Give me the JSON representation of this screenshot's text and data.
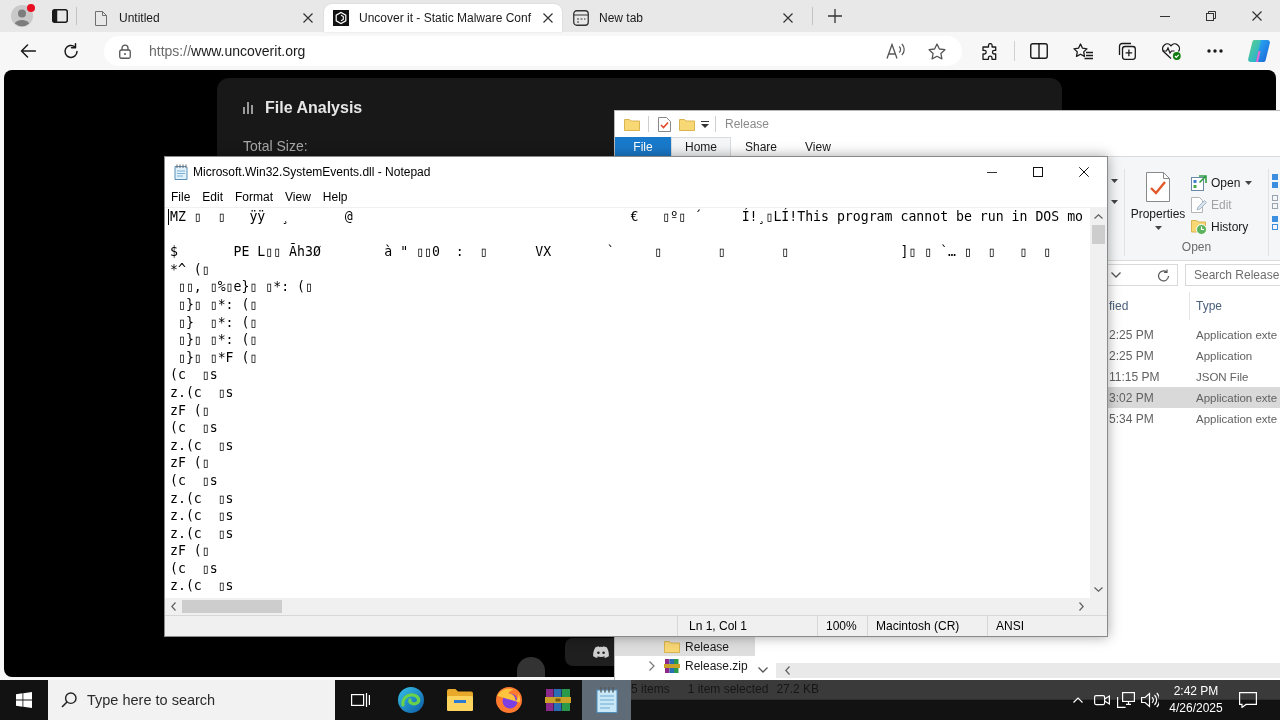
{
  "browser": {
    "profile": {
      "alert": true
    },
    "tabs": [
      {
        "kind": "page",
        "title": "Untitled",
        "selected": false
      },
      {
        "kind": "site",
        "title": "Uncover it - Static Malware Conf",
        "selected": true
      },
      {
        "kind": "newtab",
        "title": "New tab",
        "selected": false
      }
    ],
    "address": {
      "scheme": "https://",
      "host": "www.uncoverit.org"
    }
  },
  "page": {
    "heading": "File Analysis",
    "field_label": "Total Size:"
  },
  "explorer": {
    "title": "Release",
    "ribbon_tabs": [
      {
        "label": "File",
        "kind": "menu",
        "selected": false
      },
      {
        "label": "Home",
        "kind": "tab",
        "selected": true
      },
      {
        "label": "Share",
        "kind": "tab",
        "selected": false
      },
      {
        "label": "View",
        "kind": "tab",
        "selected": false
      }
    ],
    "ribbon_group": {
      "label": "Open",
      "big_button": "Properties",
      "commands": [
        {
          "label": "Open",
          "kind": "dropdown",
          "disabled": false
        },
        {
          "label": "Edit",
          "kind": "plain",
          "disabled": true
        },
        {
          "label": "History",
          "kind": "plain",
          "disabled": false
        }
      ]
    },
    "search": {
      "placeholder": "Search Release"
    },
    "columns": [
      "fied",
      "Type"
    ],
    "rows": [
      {
        "cells": [
          "2:25 PM",
          "Application exte"
        ],
        "selected": false
      },
      {
        "cells": [
          "2:25 PM",
          "Application"
        ],
        "selected": false
      },
      {
        "cells": [
          "11:15 PM",
          "JSON File"
        ],
        "selected": false
      },
      {
        "cells": [
          "3:02 PM",
          "Application exte"
        ],
        "selected": true
      },
      {
        "cells": [
          "5:34 PM",
          "Application exte"
        ],
        "selected": false
      }
    ],
    "nav": [
      {
        "label": "Release",
        "kind": "folder",
        "selected": true,
        "expandable": false
      },
      {
        "label": "Release.zip",
        "kind": "archive",
        "selected": false,
        "expandable": true
      }
    ],
    "status": {
      "count": "5 items",
      "selection": "1 item selected",
      "size": "27.2 KB"
    }
  },
  "notepad": {
    "title": "Microsoft.Win32.SystemEvents.dll - Notepad",
    "menu": [
      "File",
      "Edit",
      "Format",
      "View",
      "Help"
    ],
    "text": "MZ ▯  ▯   ÿÿ  ¸       @                                   €   ▯º▯ ´     Í!¸▯LÍ!This program cannot be run in DOS mo\n\n$       PE L▯▯ Ãh3Ø        à \" ▯▯0  :  ▯      VX       `     ▯       ▯       ▯              ]▯ ▯ `… ▯  ▯   ▯  ▯\n*^ (▯\n ▯▯, ▯%▯e}▯ ▯*: (▯\n ▯}▯ ▯*: (▯\n ▯}  ▯*: (▯\n ▯}▯ ▯*: (▯\n ▯}▯ ▯*F (▯\n(c  ▯s\nz.(c  ▯s\nzF (▯\n(c  ▯s\nz.(c  ▯s\nzF (▯\n(c  ▯s\nz.(c  ▯s\nz.(c  ▯s\nz.(c  ▯s\nzF (▯\n(c  ▯s\nz.(c  ▯s",
    "status": {
      "position": "Ln 1, Col 1",
      "zoom": "100%",
      "line_ending": "Macintosh (CR)",
      "encoding": "ANSI"
    }
  },
  "taskbar": {
    "search": {
      "placeholder": "Type here to search"
    },
    "apps": [
      {
        "kind": "taskview",
        "selected": false
      },
      {
        "kind": "edge",
        "selected": false
      },
      {
        "kind": "explorer",
        "selected": false
      },
      {
        "kind": "firefox",
        "selected": false
      },
      {
        "kind": "winrar",
        "selected": false
      },
      {
        "kind": "notepad",
        "selected": true
      }
    ],
    "time": "2:42 PM",
    "date": "4/26/2025"
  }
}
